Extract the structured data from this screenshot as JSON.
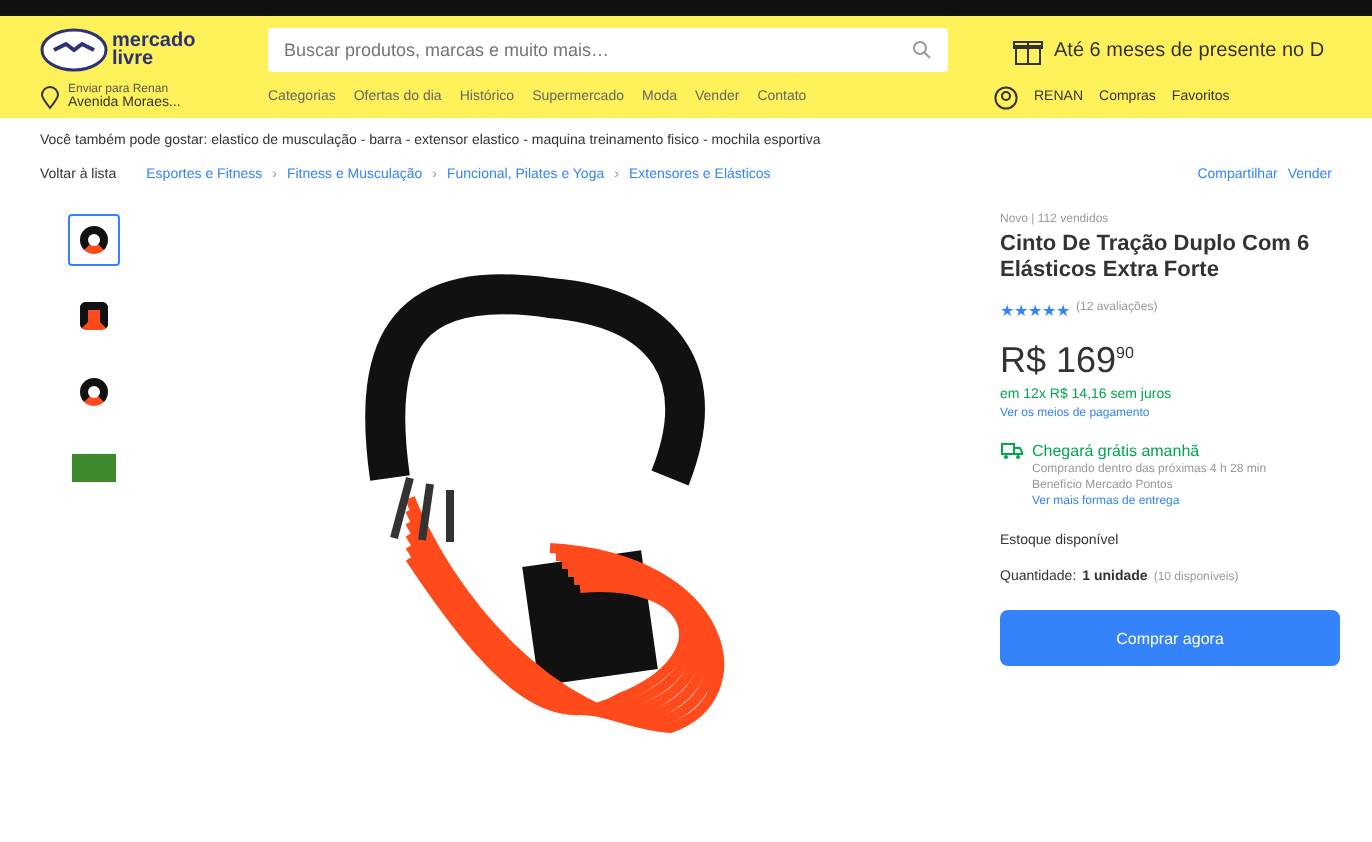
{
  "header": {
    "logo": "mercado\nlivre",
    "search": {
      "placeholder": "Buscar produtos, marcas e muito mais…"
    },
    "promo": "Até 6 meses de presente no D",
    "location": {
      "line1": "Enviar para Renan",
      "line2": "Avenida Moraes..."
    },
    "nav": [
      "Categorias",
      "Ofertas do dia",
      "Histórico",
      "Supermercado",
      "Moda",
      "Vender",
      "Contato"
    ],
    "account": {
      "user": "RENAN",
      "links": [
        "Compras",
        "Favoritos"
      ]
    }
  },
  "related": "Você também pode gostar: elastico de musculação - barra - extensor elastico - maquina treinamento fisico - mochila esportiva",
  "breadcrumb": {
    "back": "Voltar à lista",
    "separator": "›",
    "items": [
      "Esportes e Fitness",
      "Fitness e Musculação",
      "Funcional, Pilates e Yoga",
      "Extensores e Elásticos"
    ],
    "actions": [
      "Compartilhar",
      "Vender"
    ]
  },
  "thumbnails": [
    {
      "selected": true
    },
    {
      "selected": false
    },
    {
      "selected": false
    },
    {
      "selected": false
    }
  ],
  "product": {
    "condition": "Novo | 112 vendidos",
    "title": "Cinto De Tração Duplo Com 6 Elásticos Extra Forte",
    "stars": 5,
    "reviews": "(12 avaliações)",
    "price": "R$ 169",
    "cents": "90",
    "installments": "em 12x R$ 14,16 sem juros",
    "payment_link": "Ver os meios de pagamento",
    "shipping": {
      "title": "Chegará grátis amanhã",
      "line1": "Comprando dentro das próximas 4 h 28 min",
      "line2": "Benefício Mercado Pontos",
      "link": "Ver mais formas de entrega"
    },
    "stock": "Estoque disponível",
    "quantity_label": "Quantidade:",
    "quantity": "1 unidade",
    "available": "(10 disponíveis)",
    "buy": "Comprar agora"
  }
}
